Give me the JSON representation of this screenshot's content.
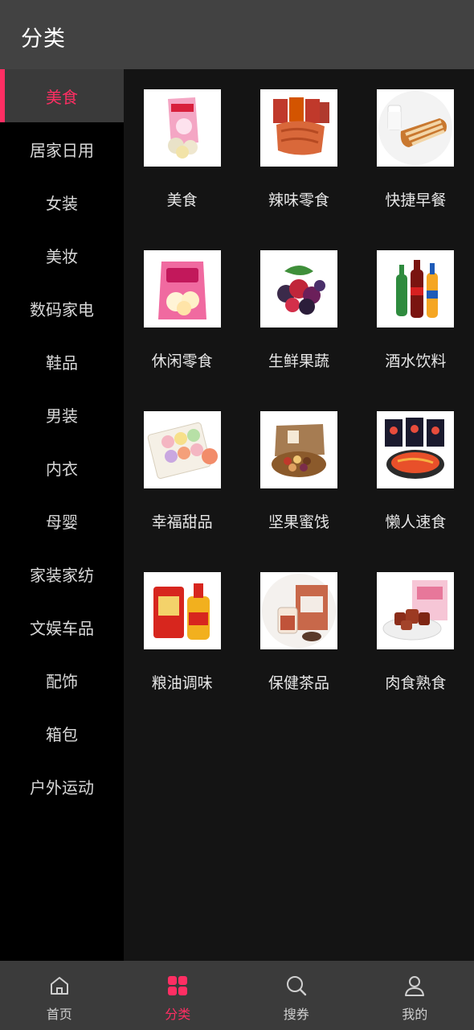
{
  "header": {
    "title": "分类"
  },
  "accent_color": "#ff2e63",
  "sidebar": {
    "active_index": 0,
    "items": [
      {
        "label": "美食"
      },
      {
        "label": "居家日用"
      },
      {
        "label": "女装"
      },
      {
        "label": "美妆"
      },
      {
        "label": "数码家电"
      },
      {
        "label": "鞋品"
      },
      {
        "label": "男装"
      },
      {
        "label": "内衣"
      },
      {
        "label": "母婴"
      },
      {
        "label": "家装家纺"
      },
      {
        "label": "文娱车品"
      },
      {
        "label": "配饰"
      },
      {
        "label": "箱包"
      },
      {
        "label": "户外运动"
      }
    ]
  },
  "categories": [
    {
      "label": "美食",
      "icon": "snack-bag-icon"
    },
    {
      "label": "辣味零食",
      "icon": "spicy-jerky-icon"
    },
    {
      "label": "快捷早餐",
      "icon": "bread-milk-icon"
    },
    {
      "label": "休闲零食",
      "icon": "snack-pack-icon"
    },
    {
      "label": "生鲜果蔬",
      "icon": "berries-icon"
    },
    {
      "label": "酒水饮料",
      "icon": "soda-bottles-icon"
    },
    {
      "label": "幸福甜品",
      "icon": "macarons-icon"
    },
    {
      "label": "坚果蜜饯",
      "icon": "nuts-box-icon"
    },
    {
      "label": "懒人速食",
      "icon": "instant-noodles-icon"
    },
    {
      "label": "粮油调味",
      "icon": "rice-oil-icon"
    },
    {
      "label": "保健茶品",
      "icon": "health-tea-icon"
    },
    {
      "label": "肉食熟食",
      "icon": "braised-meat-icon"
    }
  ],
  "tabbar": {
    "active_index": 1,
    "items": [
      {
        "label": "首页",
        "icon": "home-icon"
      },
      {
        "label": "分类",
        "icon": "grid-icon"
      },
      {
        "label": "搜券",
        "icon": "search-icon"
      },
      {
        "label": "我的",
        "icon": "user-icon"
      }
    ]
  }
}
